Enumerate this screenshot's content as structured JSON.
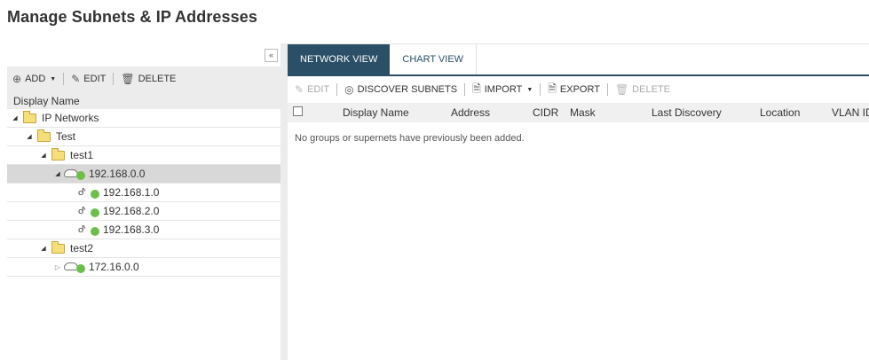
{
  "page": {
    "title": "Manage Subnets & IP Addresses"
  },
  "left_toolbar": {
    "add_label": "ADD",
    "edit_label": "EDIT",
    "delete_label": "DELETE"
  },
  "tree": {
    "header": "Display Name",
    "rows": [
      {
        "label": "IP Networks",
        "type": "folder"
      },
      {
        "label": "Test",
        "type": "folder"
      },
      {
        "label": "test1",
        "type": "folder"
      },
      {
        "label": "192.168.0.0",
        "type": "supernet"
      },
      {
        "label": "192.168.1.0",
        "type": "subnet"
      },
      {
        "label": "192.168.2.0",
        "type": "subnet"
      },
      {
        "label": "192.168.3.0",
        "type": "subnet"
      },
      {
        "label": "test2",
        "type": "folder"
      },
      {
        "label": "172.16.0.0",
        "type": "supernet"
      }
    ]
  },
  "tabs": [
    {
      "label": "NETWORK VIEW",
      "active": true
    },
    {
      "label": "CHART VIEW",
      "active": false
    }
  ],
  "right_toolbar": {
    "edit_label": "EDIT",
    "discover_label": "DISCOVER SUBNETS",
    "import_label": "IMPORT",
    "export_label": "EXPORT",
    "delete_label": "DELETE"
  },
  "table": {
    "columns": [
      "Display Name",
      "Address",
      "CIDR",
      "Mask",
      "Last Discovery",
      "Location",
      "VLAN ID"
    ],
    "empty_message": "No groups or supernets have previously been added."
  },
  "colors": {
    "accent": "#2a4f66",
    "status_green": "#6cc04a",
    "folder": "#f6de7a"
  }
}
